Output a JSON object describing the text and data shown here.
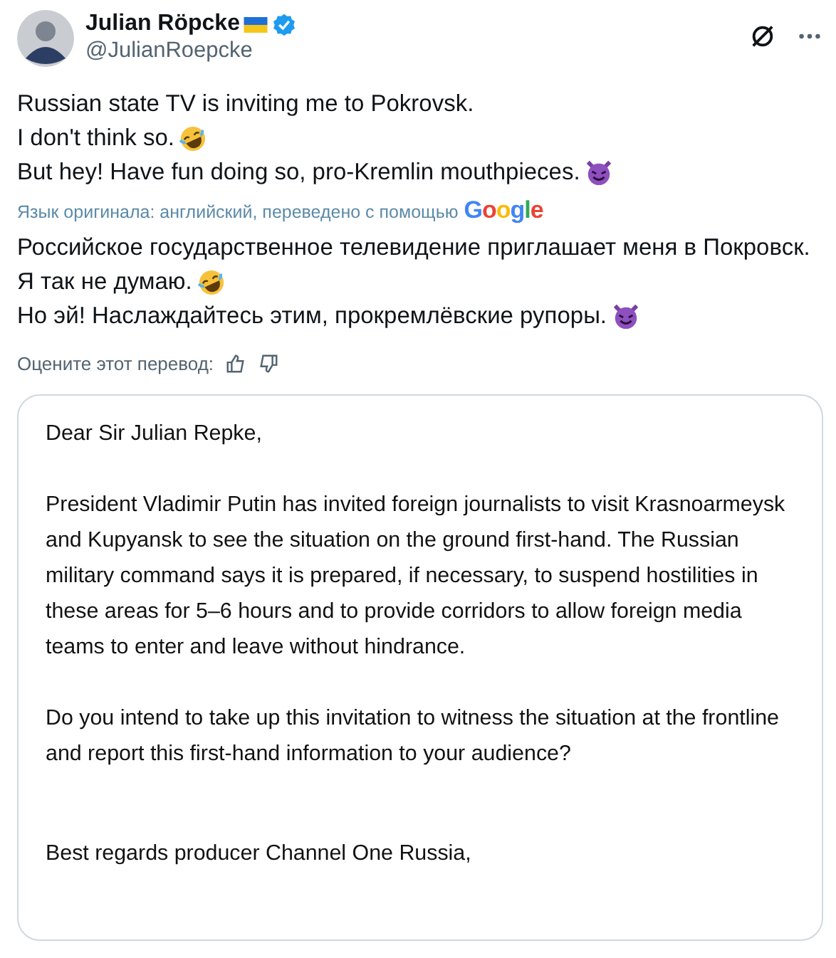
{
  "author": {
    "name": "Julian Röpcke",
    "handle": "@JulianRoepcke",
    "verified": true
  },
  "tweet_lines": [
    {
      "text": "Russian state TV is inviting me to Pokrovsk.",
      "kind": "plain"
    },
    {
      "text": "I don't think so.",
      "kind": "laughing"
    },
    {
      "text": "But hey! Have fun doing so, pro-Kremlin mouthpieces.",
      "kind": "devil"
    }
  ],
  "translation_note": {
    "text": "Язык оригинала: английский, переведено с помощью",
    "provider": "Google"
  },
  "translated_lines": [
    {
      "text": "Российское государственное телевидение приглашает меня в Покровск.",
      "kind": "plain"
    },
    {
      "text": "Я так не думаю.",
      "kind": "laughing"
    },
    {
      "text": "Но эй! Наслаждайтесь этим, прокремлёвские рупоры.",
      "kind": "devil"
    }
  ],
  "rate_prompt": "Оцените этот перевод:",
  "letter": {
    "paragraphs": [
      [
        "Dear Sir Julian Repke,"
      ],
      [
        "President Vladimir Putin has invited foreign journalists to visit Krasnoarmeysk",
        "and Kupyansk to see the situation on the ground first-hand. The Russian",
        "military command says it is prepared, if necessary, to suspend hostilities in",
        "these areas for 5–6 hours and to provide corridors to allow foreign media",
        "teams to enter and leave without hindrance."
      ],
      [
        "Do you intend to take up this invitation to witness the situation at the frontline",
        "and report this first-hand information to your audience?"
      ],
      [
        "Best regards producer Channel One Russia,"
      ]
    ]
  }
}
